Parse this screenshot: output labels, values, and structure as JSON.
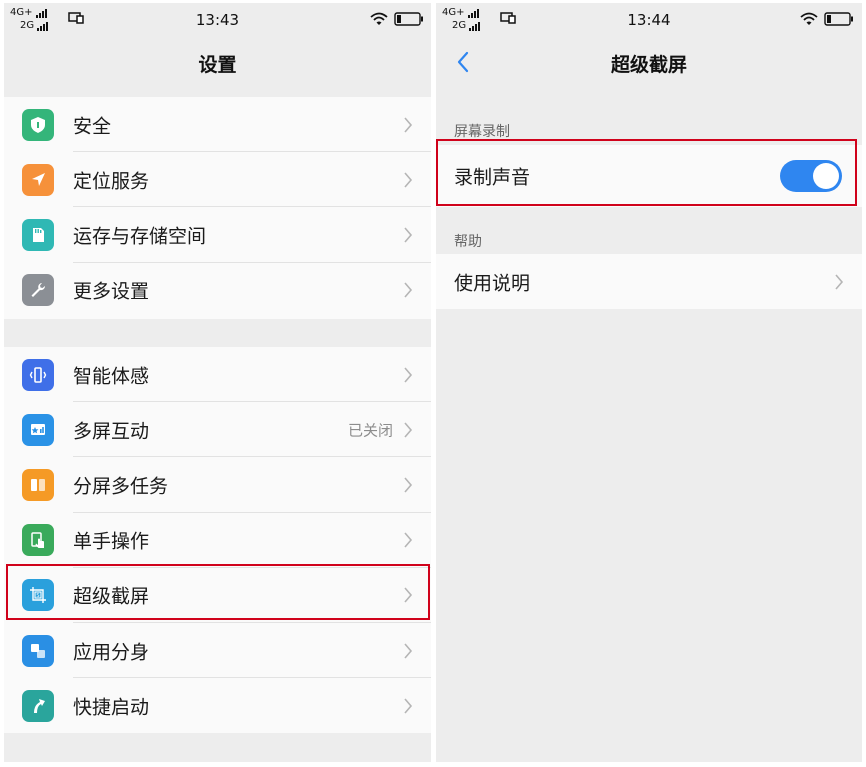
{
  "status_left": {
    "network_line1": "4G+",
    "network_line2": "2G",
    "time": "13:43"
  },
  "status_right": {
    "network_line1": "4G+",
    "network_line2": "2G",
    "time": "13:44"
  },
  "settings": {
    "title": "设置",
    "group1": [
      {
        "label": "安全",
        "icon": "shield-icon",
        "color": "#34b57a"
      },
      {
        "label": "定位服务",
        "icon": "location-arrow-icon",
        "color": "#f6913a"
      },
      {
        "label": "运存与存储空间",
        "icon": "sd-card-icon",
        "color": "#2fb8b4"
      },
      {
        "label": "更多设置",
        "icon": "wrench-icon",
        "color": "#8b8f95"
      }
    ],
    "group2": [
      {
        "label": "智能体感",
        "icon": "phone-vibrate-icon",
        "color": "#3f6fe8",
        "value": ""
      },
      {
        "label": "多屏互动",
        "icon": "multi-screen-icon",
        "color": "#2a92e6",
        "value": "已关闭"
      },
      {
        "label": "分屏多任务",
        "icon": "split-screen-icon",
        "color": "#f59a26",
        "value": ""
      },
      {
        "label": "单手操作",
        "icon": "one-hand-icon",
        "color": "#3aaa5b",
        "value": ""
      },
      {
        "label": "超级截屏",
        "icon": "screenshot-icon",
        "color": "#2aa0dc",
        "value": ""
      },
      {
        "label": "应用分身",
        "icon": "app-clone-icon",
        "color": "#2a8fe4",
        "value": ""
      },
      {
        "label": "快捷启动",
        "icon": "quick-launch-icon",
        "color": "#2aa59c",
        "value": ""
      }
    ]
  },
  "super_screenshot": {
    "title": "超级截屏",
    "section_record": "屏幕录制",
    "record_audio_label": "录制声音",
    "record_audio_on": true,
    "section_help": "帮助",
    "usage_label": "使用说明"
  },
  "colors": {
    "accent": "#2f86f0",
    "highlight": "#d0021b"
  }
}
